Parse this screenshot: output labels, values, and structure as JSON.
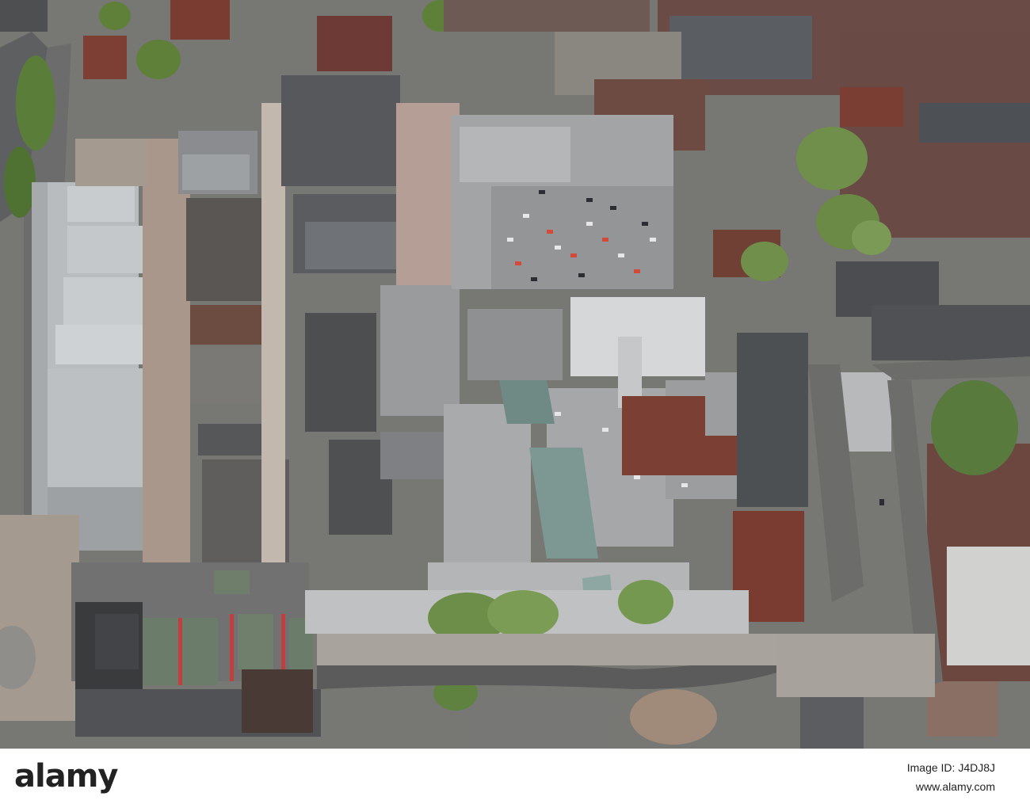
{
  "image": {
    "subject": "aerial-view-town-centre-shopping-precinct",
    "palette": {
      "roof_dark": "#4b4d50",
      "roof_grey": "#8c8f92",
      "roof_light": "#c9ccce",
      "brick": "#7a3b30",
      "road": "#6a6a68",
      "paving": "#b7b2aa",
      "trees": "#6f8f4a",
      "car_park_marking": "#3f9a3a",
      "glass": "#6f8a84"
    }
  },
  "watermark": {
    "brand": "alamy",
    "image_id": "Image ID: J4DJ8J",
    "url": "www.alamy.com"
  }
}
